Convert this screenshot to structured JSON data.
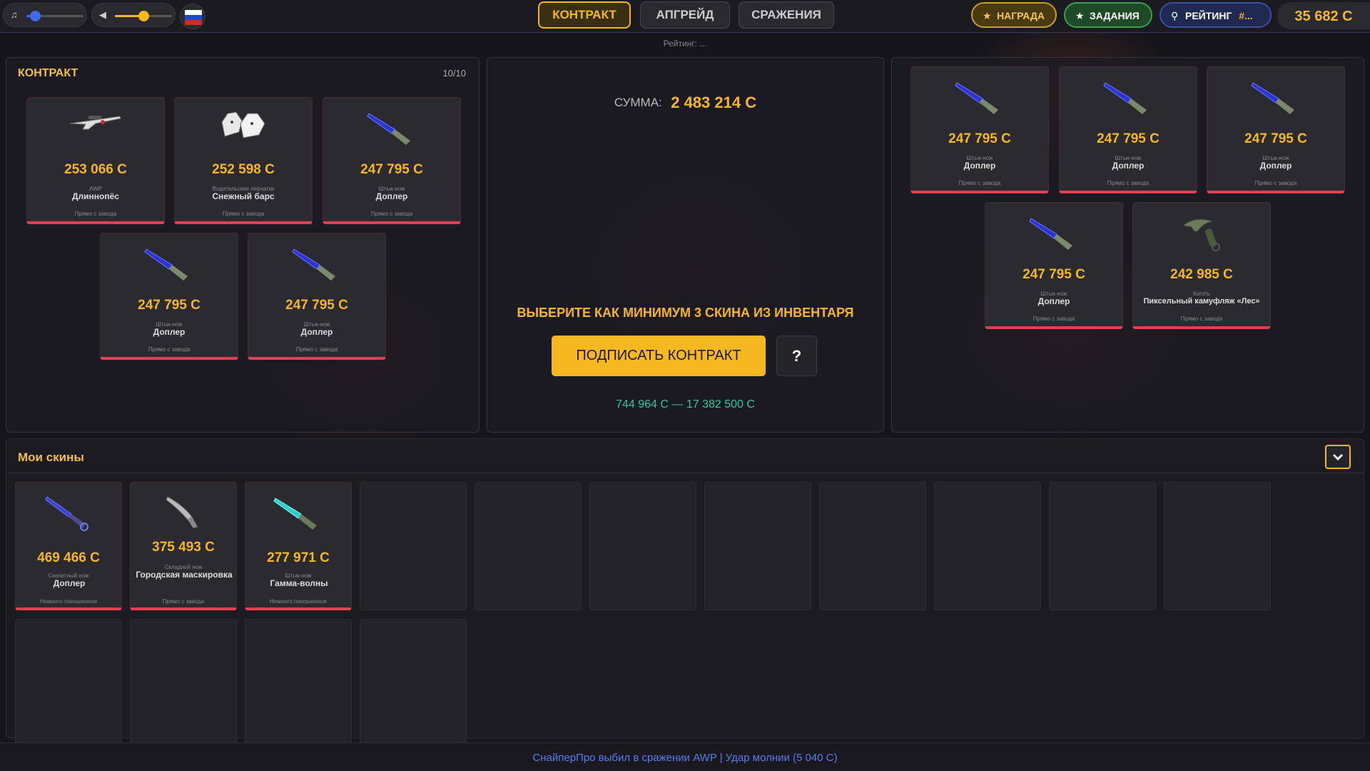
{
  "topbar": {
    "music_icon": "music-note-icon",
    "volume_icon": "speaker-icon",
    "music_level": 0.15,
    "volume_level": 0.5,
    "tabs": [
      {
        "label": "КОНТРАКТ",
        "active": true
      },
      {
        "label": "АПГРЕЙД",
        "active": false
      },
      {
        "label": "СРАЖЕНИЯ",
        "active": false
      }
    ],
    "reward_label": "НАГРАДА",
    "tasks_label": "ЗАДАНИЯ",
    "rating_label": "РЕЙТИНГ",
    "rating_value": "#...",
    "balance": "35 682 C",
    "rating_sub": "Рейтинг: ..."
  },
  "contract": {
    "title": "КОНТРАКТ",
    "count": "10/10",
    "items": [
      {
        "price": "253 066 C",
        "type": "AWP",
        "name": "Длиннопёс",
        "wear": "Прямо с завода",
        "icon": "sniper-rifle-icon"
      },
      {
        "price": "252 598 C",
        "type": "Водительские перчатки",
        "name": "Снежный барс",
        "wear": "Прямо с завода",
        "icon": "gloves-icon"
      },
      {
        "price": "247 795 C",
        "type": "Штык-нож",
        "name": "Доплер",
        "wear": "Прямо с завода",
        "icon": "bayonet-knife-icon"
      },
      {
        "price": "247 795 C",
        "type": "Штык-нож",
        "name": "Доплер",
        "wear": "Прямо с завода",
        "icon": "bayonet-knife-icon"
      },
      {
        "price": "247 795 C",
        "type": "Штык-нож",
        "name": "Доплер",
        "wear": "Прямо с завода",
        "icon": "bayonet-knife-icon"
      }
    ]
  },
  "center": {
    "sum_label": "СУММА:",
    "sum_value": "2 483 214 C",
    "hint": "ВЫБЕРИТЕ КАК МИНИМУМ 3 СКИНА ИЗ ИНВЕНТАРЯ",
    "sign_button": "ПОДПИСАТЬ КОНТРАКТ",
    "help_button": "?",
    "range": "744 964 C — 17 382 500 C"
  },
  "right": {
    "items": [
      {
        "price": "247 795 C",
        "type": "Штык-нож",
        "name": "Доплер",
        "wear": "Прямо с завода",
        "icon": "bayonet-knife-icon"
      },
      {
        "price": "247 795 C",
        "type": "Штык-нож",
        "name": "Доплер",
        "wear": "Прямо с завода",
        "icon": "bayonet-knife-icon"
      },
      {
        "price": "247 795 C",
        "type": "Штык-нож",
        "name": "Доплер",
        "wear": "Прямо с завода",
        "icon": "bayonet-knife-icon"
      },
      {
        "price": "247 795 C",
        "type": "Штык-нож",
        "name": "Доплер",
        "wear": "Прямо с завода",
        "icon": "bayonet-knife-icon"
      },
      {
        "price": "242 985 C",
        "type": "Коготь",
        "name": "Пиксельный камуфляж «Лес»",
        "wear": "Прямо с завода",
        "icon": "karambit-icon"
      }
    ]
  },
  "inventory": {
    "title": "Мои скины",
    "items": [
      {
        "price": "469 466 C",
        "type": "Скелетный нож",
        "name": "Доплер",
        "wear": "Немного поношенное",
        "icon": "skeleton-knife-icon"
      },
      {
        "price": "375 493 C",
        "type": "Складной нож",
        "name": "Городская маскировка",
        "wear": "Прямо с завода",
        "icon": "flip-knife-icon"
      },
      {
        "price": "277 971 C",
        "type": "Штык-нож",
        "name": "Гамма-волны",
        "wear": "Немного поношенное",
        "icon": "bayonet-knife-icon"
      }
    ],
    "empty_slots": 12
  },
  "footer": {
    "text": "СнайперПро выбил в сражении AWP | Удар молнии (5 040 C)"
  },
  "colors": {
    "accent": "#f6b820",
    "rarity_red": "#e04050",
    "range_green": "#2fc9a0",
    "footer_blue": "#5a7cf0"
  }
}
